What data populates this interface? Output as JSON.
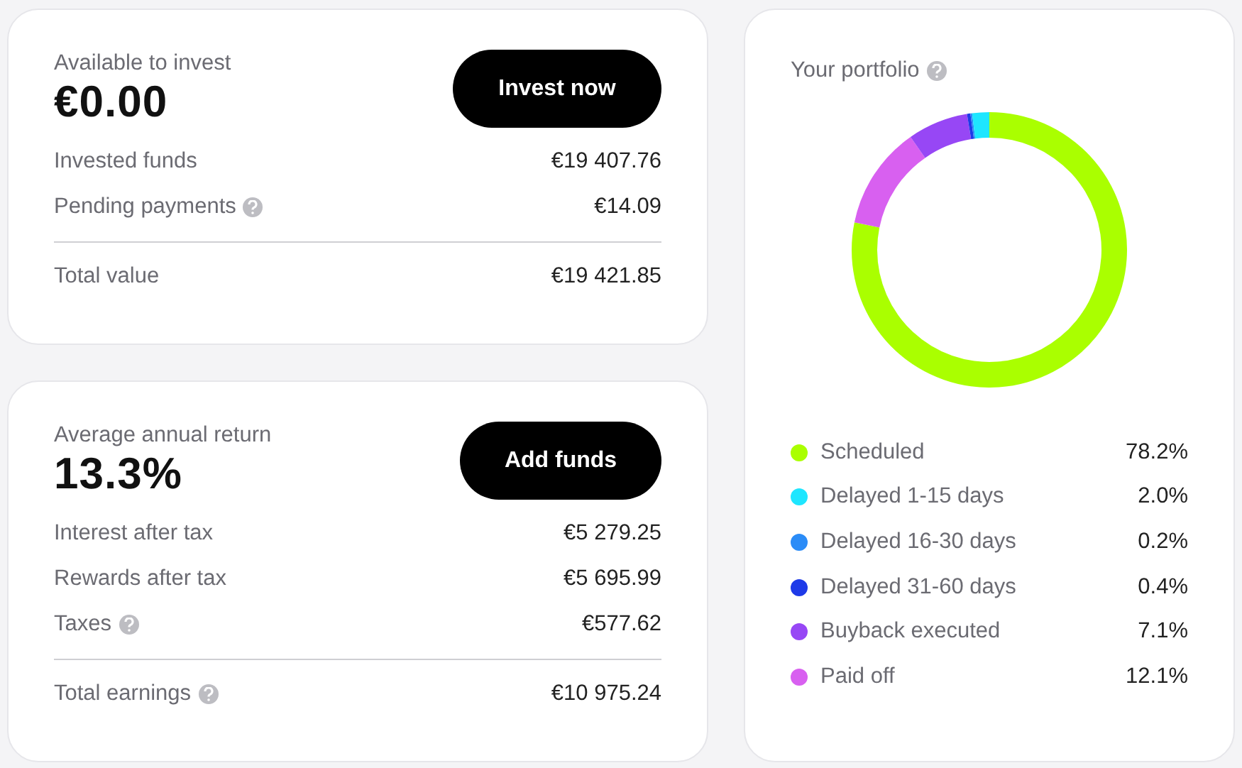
{
  "summary_card": {
    "label": "Available to invest",
    "amount": "€0.00",
    "button": "Invest now",
    "rows": [
      {
        "label": "Invested funds",
        "value": "€19 407.76",
        "help": false
      },
      {
        "label": "Pending payments",
        "value": "€14.09",
        "help": true
      }
    ],
    "total": {
      "label": "Total value",
      "value": "€19 421.85",
      "help": false
    }
  },
  "returns_card": {
    "label": "Average annual return",
    "amount": "13.3%",
    "button": "Add funds",
    "rows": [
      {
        "label": "Interest after tax",
        "value": "€5 279.25",
        "help": false
      },
      {
        "label": "Rewards after tax",
        "value": "€5 695.99",
        "help": false
      },
      {
        "label": "Taxes",
        "value": "€577.62",
        "help": true
      }
    ],
    "total": {
      "label": "Total earnings",
      "value": "€10 975.24",
      "help": true
    }
  },
  "portfolio": {
    "title": "Your portfolio",
    "help": true,
    "chart_data": {
      "type": "donut",
      "categories": [
        "Scheduled",
        "Delayed 1-15 days",
        "Delayed 16-30 days",
        "Delayed 31-60 days",
        "Buyback executed",
        "Paid off"
      ],
      "values": [
        78.2,
        2.0,
        0.2,
        0.4,
        7.1,
        12.1
      ]
    },
    "legend": [
      {
        "value": "78.2%",
        "color": "#aaff00"
      },
      {
        "value": "2.0%",
        "color": "#1ee6ff"
      },
      {
        "value": "0.2%",
        "color": "#2b8cf7"
      },
      {
        "value": "0.4%",
        "color": "#1e3ae8"
      },
      {
        "value": "7.1%",
        "color": "#9747f5"
      },
      {
        "value": "12.1%",
        "color": "#d860f0"
      }
    ]
  }
}
